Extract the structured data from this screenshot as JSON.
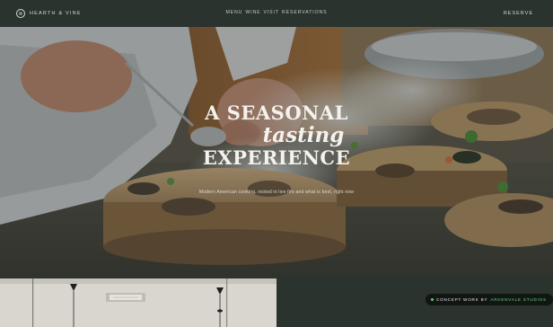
{
  "brand": {
    "name": "HEARTH & VINE",
    "logo_icon": "pause-circle-icon"
  },
  "nav": {
    "items": [
      {
        "label": "MENU"
      },
      {
        "label": "WINE"
      },
      {
        "label": "VISIT"
      },
      {
        "label": "RESERVATIONS"
      }
    ]
  },
  "header": {
    "reserve_label": "RESERVE"
  },
  "hero": {
    "line1": "A SEASONAL",
    "line2": "tasting",
    "line3": "EXPERIENCE",
    "subtitle": "Modern American cooking, rooted in live fire and what is best, right now"
  },
  "credit": {
    "label": "CONCEPT WORK BY",
    "studio": "ARKENVALE STUDIOS",
    "dot_color": "#5fd07a"
  },
  "colors": {
    "background": "#2a332e",
    "text_light": "#f4f2ec",
    "accent": "#6fd58a"
  }
}
